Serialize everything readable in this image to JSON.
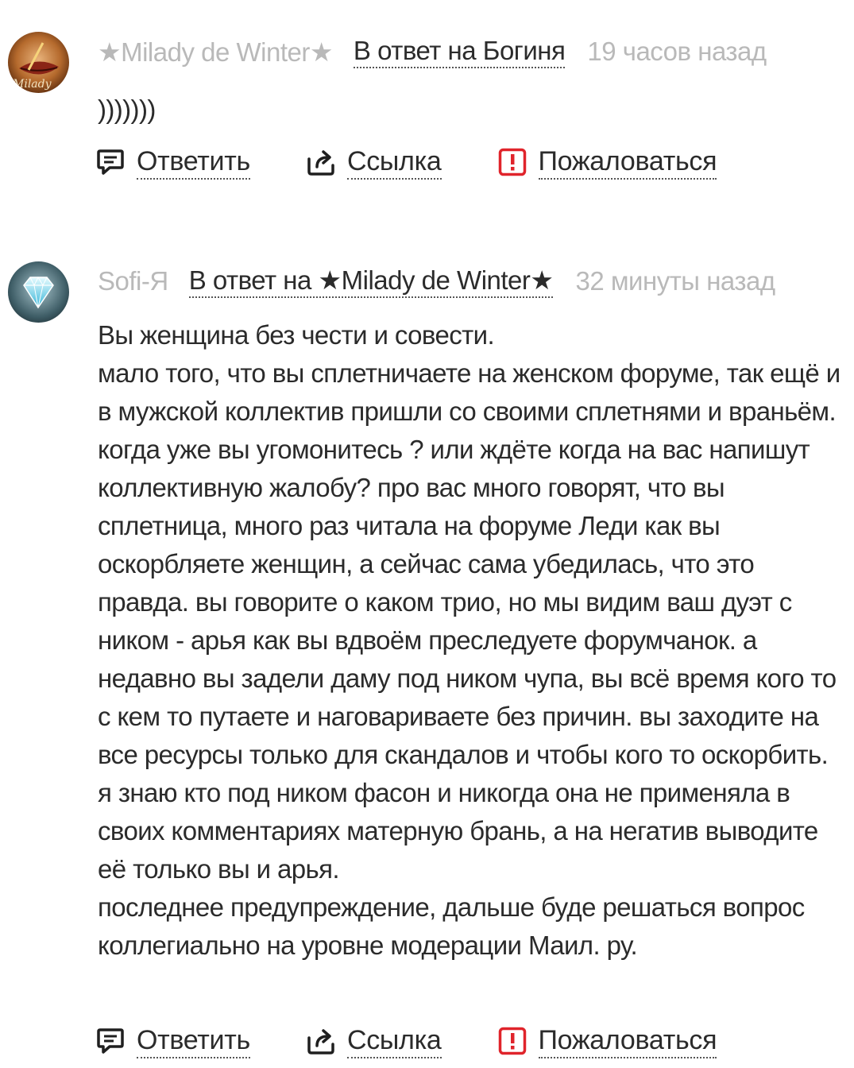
{
  "comments": [
    {
      "author": "★Milady de Winter★",
      "reply_to": "В ответ на Богиня",
      "time": "19 часов назад",
      "body": [
        ")))))))"
      ],
      "avatar_icon": "lips-avatar-icon"
    },
    {
      "author": "Sofi-Я",
      "reply_to": "В ответ на ★Milady de Winter★",
      "time": "32 минуты назад",
      "body": [
        "Вы женщина без чести и совести.",
        "мало того, что вы сплетничаете на женском форуме, так ещё и в мужской коллектив пришли со своими сплетнями и враньём. когда уже вы угомонитесь ? или ждёте когда на вас напишут коллективную жалобу? про вас много говорят, что вы сплетница, много раз читала на форуме Леди как вы оскорбляете женщин, а сейчас сама убедилась, что это правда. вы говорите о каком трио, но мы видим ваш дуэт с ником - арья как вы вдвоём преследуете форумчанок. а недавно вы задели даму под ником чупа, вы всё время кого то с кем то путаете и наговариваете без причин. вы заходите на все ресурсы только для скандалов и чтобы кого то оскорбить. я знаю кто под ником фасон и никогда она не применяла в своих комментариях матерную брань, а на негатив выводите её только вы и арья.",
        "последнее предупреждение, дальше буде решаться вопрос коллегиально на уровне модерации Маил. ру."
      ],
      "avatar_icon": "diamond-avatar-icon"
    }
  ],
  "actions": {
    "reply_label": "Ответить",
    "link_label": "Ссылка",
    "report_label": "Пожаловаться"
  },
  "icons": {
    "reply": "speech-bubble-icon",
    "link": "share-arrow-icon",
    "report": "exclamation-box-icon"
  },
  "colors": {
    "report_red": "#e0242b",
    "muted_text": "#b9b9b9",
    "body_text": "#2b2b2b"
  }
}
